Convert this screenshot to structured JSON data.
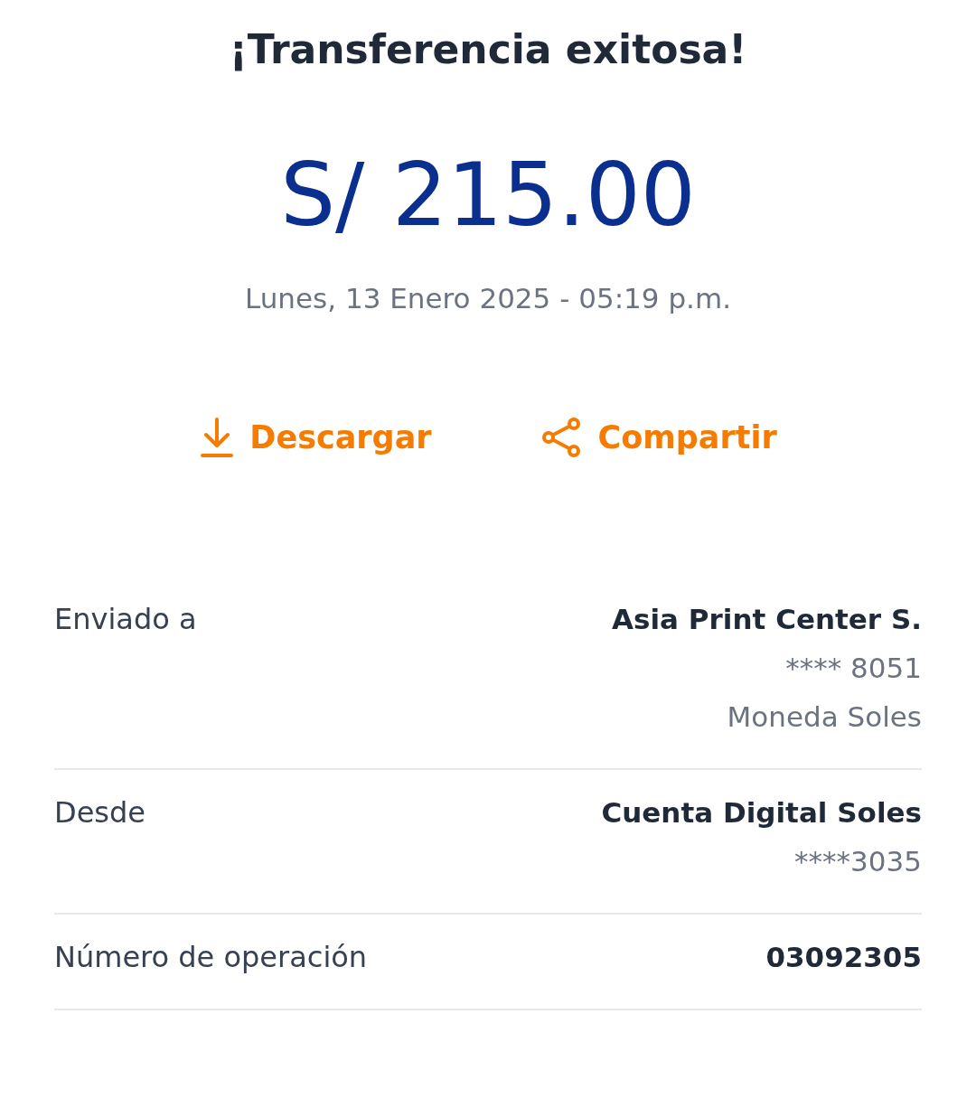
{
  "title": "¡Transferencia exitosa!",
  "amount": "S/ 215.00",
  "datetime": "Lunes, 13 Enero 2025 - 05:19 p.m.",
  "actions": [
    {
      "kind": "download",
      "label": "Descargar"
    },
    {
      "kind": "share",
      "label": "Compartir"
    }
  ],
  "details": [
    {
      "label": "Enviado a",
      "lines": [
        "Asia Print Center S.",
        "**** 8051",
        "Moneda Soles"
      ]
    },
    {
      "label": "Desde",
      "lines": [
        "Cuenta Digital Soles",
        "****3035"
      ]
    },
    {
      "label": "Número de operación",
      "lines": [
        "03092305"
      ]
    }
  ]
}
